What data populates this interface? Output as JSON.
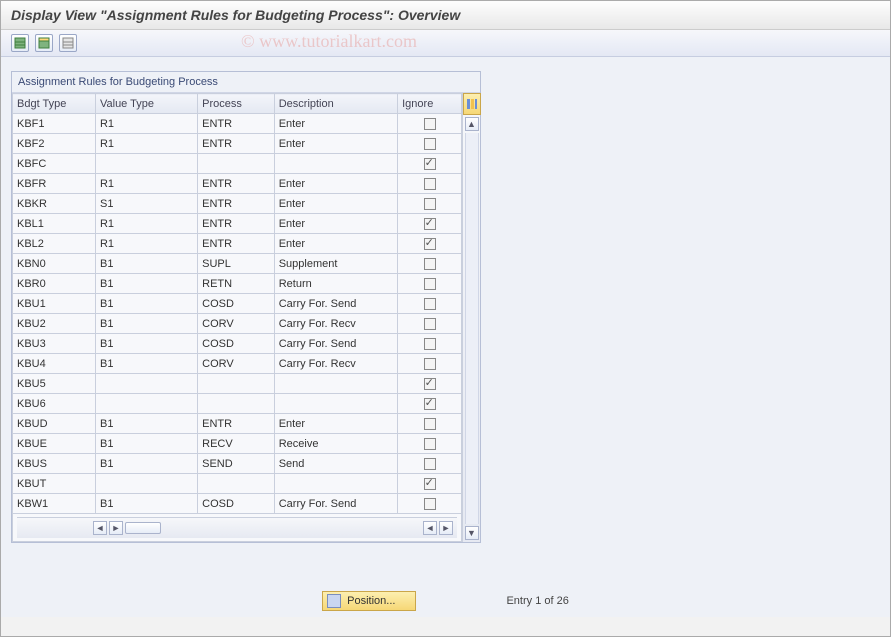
{
  "title": "Display View \"Assignment Rules for Budgeting Process\": Overview",
  "watermark": "©  www.tutorialkart.com",
  "panel_title": "Assignment Rules for Budgeting Process",
  "columns": {
    "bdgt": "Bdgt Type",
    "val": "Value Type",
    "proc": "Process",
    "desc": "Description",
    "ign": "Ignore"
  },
  "rows": [
    {
      "bdgt": "KBF1",
      "val": "R1",
      "proc": "ENTR",
      "desc": "Enter",
      "ign": false
    },
    {
      "bdgt": "KBF2",
      "val": "R1",
      "proc": "ENTR",
      "desc": "Enter",
      "ign": false
    },
    {
      "bdgt": "KBFC",
      "val": "",
      "proc": "",
      "desc": "",
      "ign": true
    },
    {
      "bdgt": "KBFR",
      "val": "R1",
      "proc": "ENTR",
      "desc": "Enter",
      "ign": false
    },
    {
      "bdgt": "KBKR",
      "val": "S1",
      "proc": "ENTR",
      "desc": "Enter",
      "ign": false
    },
    {
      "bdgt": "KBL1",
      "val": "R1",
      "proc": "ENTR",
      "desc": "Enter",
      "ign": true
    },
    {
      "bdgt": "KBL2",
      "val": "R1",
      "proc": "ENTR",
      "desc": "Enter",
      "ign": true
    },
    {
      "bdgt": "KBN0",
      "val": "B1",
      "proc": "SUPL",
      "desc": "Supplement",
      "ign": false
    },
    {
      "bdgt": "KBR0",
      "val": "B1",
      "proc": "RETN",
      "desc": "Return",
      "ign": false
    },
    {
      "bdgt": "KBU1",
      "val": "B1",
      "proc": "COSD",
      "desc": "Carry For. Send",
      "ign": false
    },
    {
      "bdgt": "KBU2",
      "val": "B1",
      "proc": "CORV",
      "desc": "Carry For. Recv",
      "ign": false
    },
    {
      "bdgt": "KBU3",
      "val": "B1",
      "proc": "COSD",
      "desc": "Carry For. Send",
      "ign": false
    },
    {
      "bdgt": "KBU4",
      "val": "B1",
      "proc": "CORV",
      "desc": "Carry For. Recv",
      "ign": false
    },
    {
      "bdgt": "KBU5",
      "val": "",
      "proc": "",
      "desc": "",
      "ign": true
    },
    {
      "bdgt": "KBU6",
      "val": "",
      "proc": "",
      "desc": "",
      "ign": true
    },
    {
      "bdgt": "KBUD",
      "val": "B1",
      "proc": "ENTR",
      "desc": "Enter",
      "ign": false
    },
    {
      "bdgt": "KBUE",
      "val": "B1",
      "proc": "RECV",
      "desc": "Receive",
      "ign": false
    },
    {
      "bdgt": "KBUS",
      "val": "B1",
      "proc": "SEND",
      "desc": "Send",
      "ign": false
    },
    {
      "bdgt": "KBUT",
      "val": "",
      "proc": "",
      "desc": "",
      "ign": true
    },
    {
      "bdgt": "KBW1",
      "val": "B1",
      "proc": "COSD",
      "desc": "Carry For. Send",
      "ign": false
    }
  ],
  "footer": {
    "position_label": "Position...",
    "entry_text": "Entry 1 of 26"
  }
}
